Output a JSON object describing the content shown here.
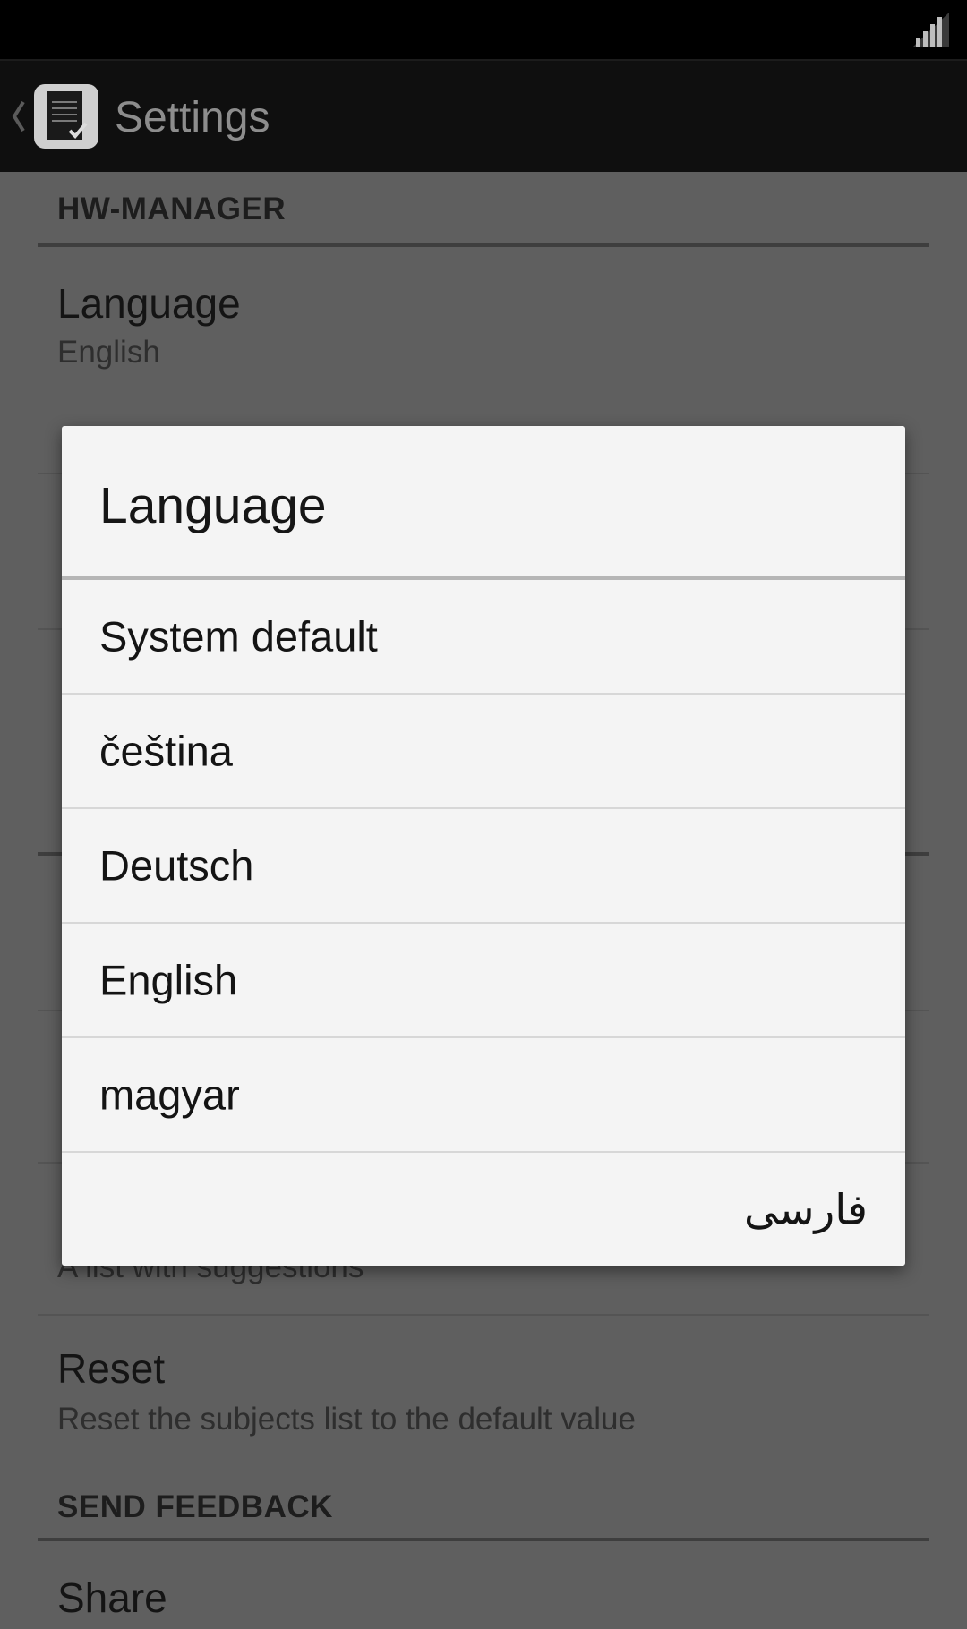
{
  "action_bar": {
    "title": "Settings",
    "app_icon": "document-check-icon",
    "up_icon": "chevron-left-icon"
  },
  "status_bar": {
    "signal_icon": "signal-bars-icon"
  },
  "settings": {
    "category_1": "HW-MANAGER",
    "language": {
      "title": "Language",
      "summary": "English"
    },
    "suggestions": {
      "summary": "A list with suggestions"
    },
    "reset": {
      "title": "Reset",
      "summary": "Reset the subjects list to the default value"
    },
    "category_2": "SEND FEEDBACK",
    "share": {
      "title": "Share"
    }
  },
  "dialog": {
    "title": "Language",
    "options": [
      {
        "label": "System default"
      },
      {
        "label": "čeština"
      },
      {
        "label": "Deutsch"
      },
      {
        "label": "English"
      },
      {
        "label": "magyar"
      },
      {
        "label": "فارسی"
      }
    ]
  },
  "colors": {
    "scrim": "#5f5f5f",
    "dialog_bg": "#f4f4f4",
    "action_bar": "#0f0f0f"
  }
}
